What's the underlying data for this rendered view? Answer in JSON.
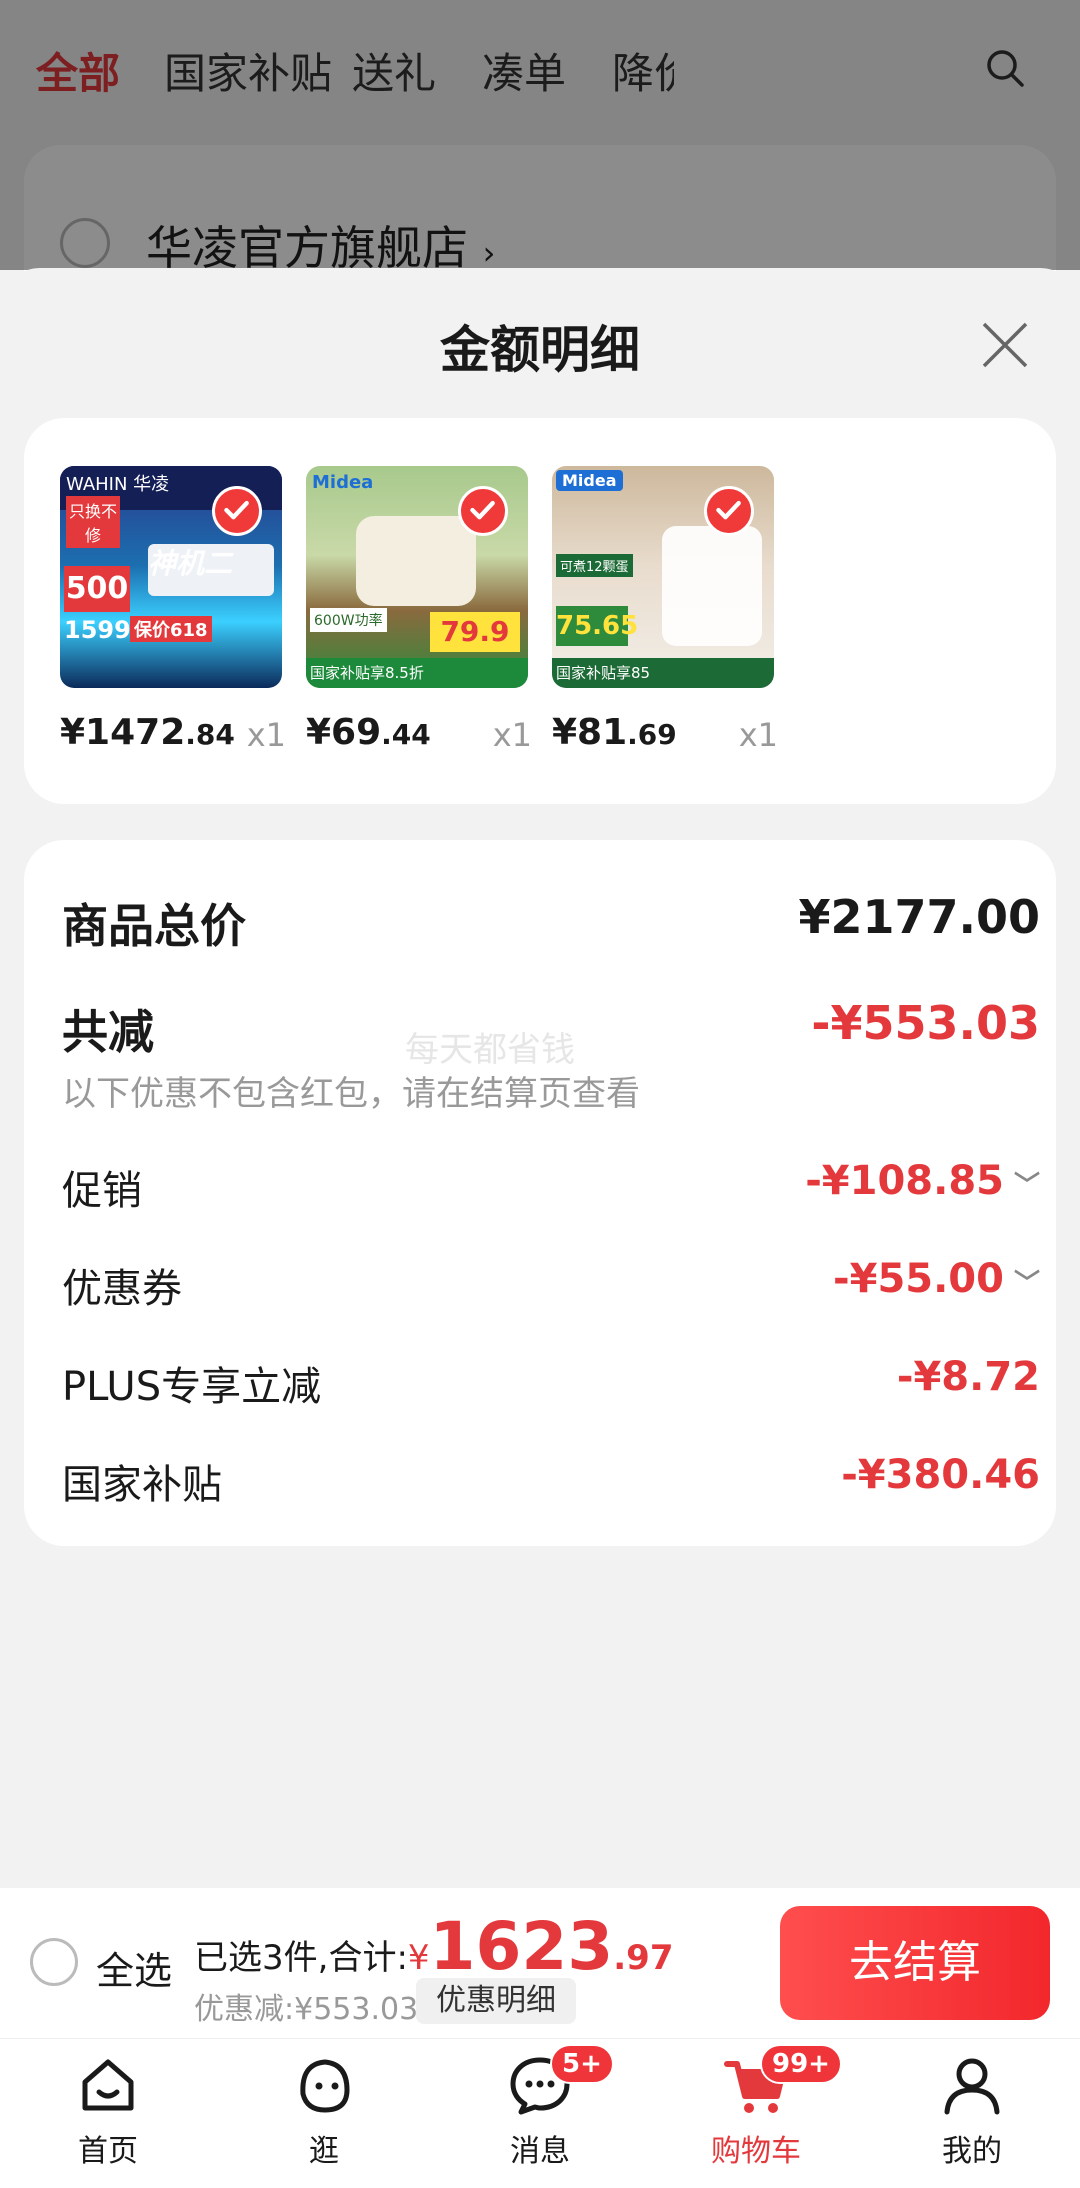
{
  "colors": {
    "accent": "#e4393c",
    "checkout_button": "#f2272c",
    "sheet_bg": "#f2f2f2"
  },
  "top_tabs": [
    "全部",
    "国家补贴",
    "送礼",
    "凑单",
    "降价"
  ],
  "store": {
    "name": "华凌官方旗舰店",
    "chevron": "›"
  },
  "sheet": {
    "title": "金额明细"
  },
  "products": [
    {
      "price_int": "¥1472",
      "price_dec": ".84",
      "qty": "x1",
      "thumb_labels": [
        "WAHIN 华凌",
        "只换不修",
        "神机二",
        "500",
        "1599.2",
        "保价618"
      ]
    },
    {
      "price_int": "¥69",
      "price_dec": ".44",
      "qty": "x1",
      "thumb_labels": [
        "Midea",
        "600W功率",
        "79.9",
        "国家补贴享8.5折"
      ]
    },
    {
      "price_int": "¥81",
      "price_dec": ".69",
      "qty": "x1",
      "thumb_labels": [
        "Midea",
        "可煮12颗蛋",
        "75.65",
        "国家补贴享85"
      ]
    }
  ],
  "summary": {
    "total_label": "商品总价",
    "total_value": "¥2177.00",
    "reduce_label": "共减",
    "reduce_value": "-¥553.03",
    "reduce_note": "以下优惠不包含红包，请在结算页查看",
    "watermark": "每天都省钱",
    "items": [
      {
        "label": "促销",
        "value": "-¥108.85",
        "expandable": true
      },
      {
        "label": "优惠券",
        "value": "-¥55.00",
        "expandable": true
      },
      {
        "label": "PLUS专享立减",
        "value": "-¥8.72",
        "expandable": false
      },
      {
        "label": "国家补贴",
        "value": "-¥380.46",
        "expandable": false
      }
    ]
  },
  "checkout": {
    "select_all": "全选",
    "selected_text": "已选3件,合计:",
    "yen": "¥",
    "total_int": "1623",
    "total_dec": ".97",
    "discount_text": "优惠减:¥553.03",
    "detail_button": "优惠明细",
    "checkout_button": "去结算"
  },
  "tabbar": [
    {
      "label": "首页",
      "icon": "home-icon"
    },
    {
      "label": "逛",
      "icon": "face-icon"
    },
    {
      "label": "消息",
      "icon": "message-icon",
      "badge": "5+"
    },
    {
      "label": "购物车",
      "icon": "cart-icon",
      "badge": "99+",
      "active": true
    },
    {
      "label": "我的",
      "icon": "profile-icon"
    }
  ]
}
